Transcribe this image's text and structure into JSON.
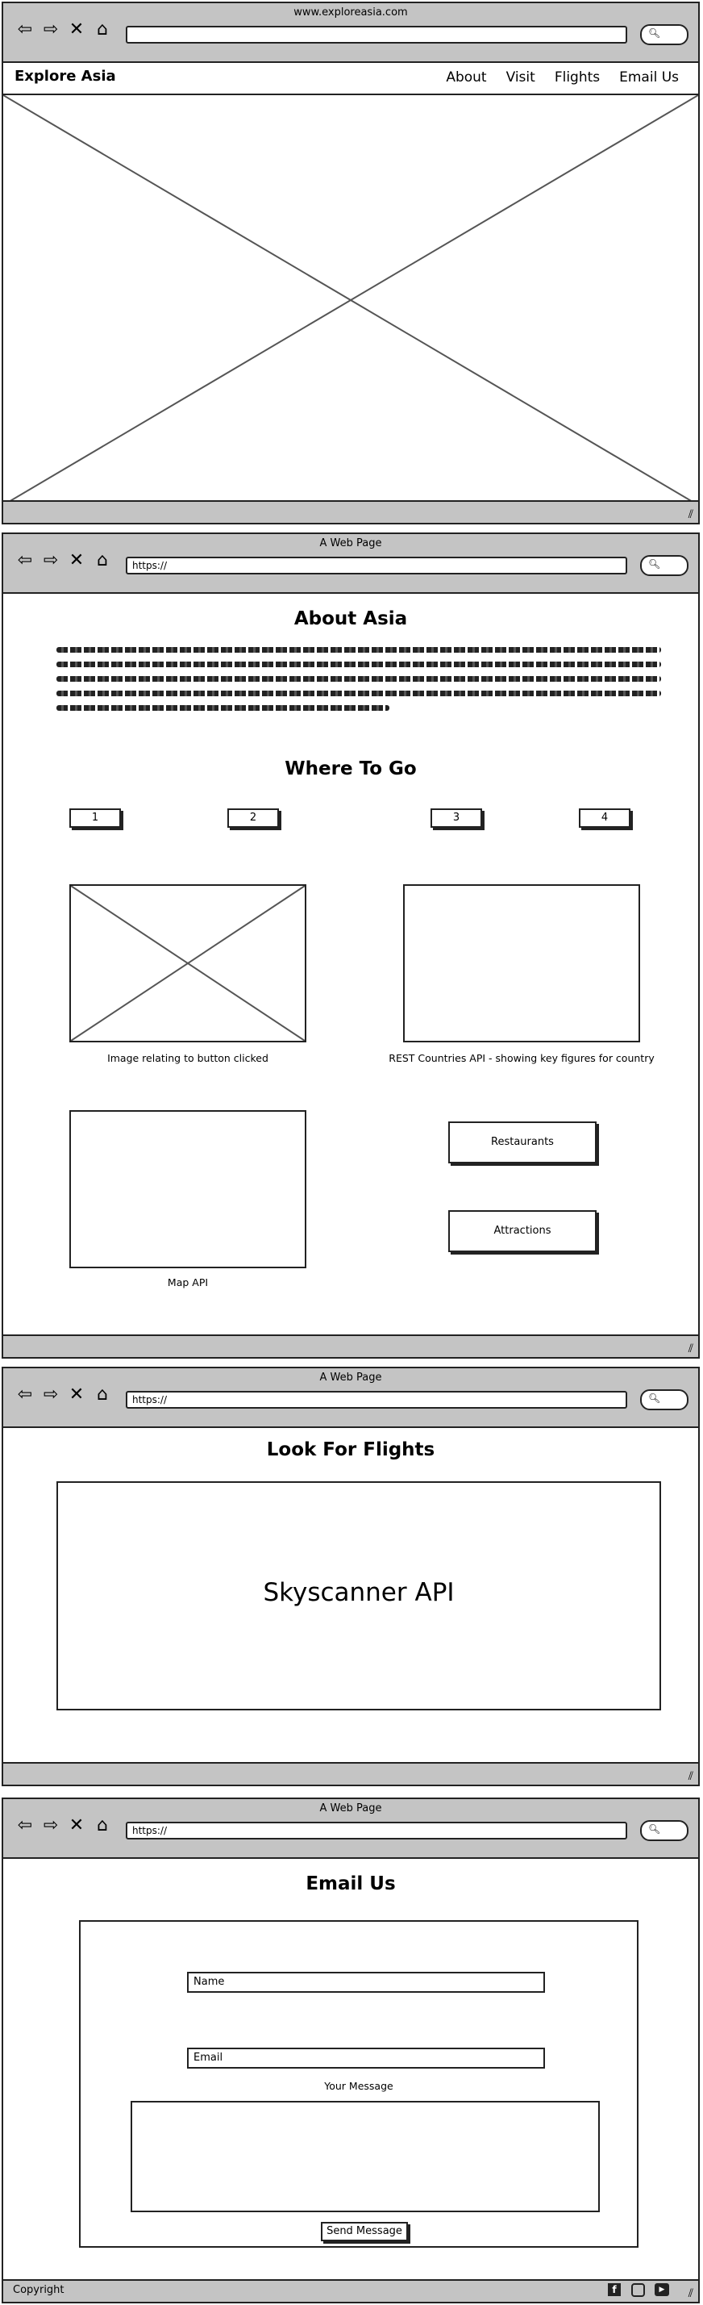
{
  "frame1": {
    "window_title": "www.exploreasia.com",
    "url": "",
    "brand": "Explore Asia",
    "nav": [
      "About",
      "Visit",
      "Flights",
      "Email Us"
    ]
  },
  "frame2": {
    "window_title": "A Web Page",
    "url": "https://",
    "about_heading": "About Asia",
    "where_heading": "Where To Go",
    "buttons": [
      "1",
      "2",
      "3",
      "4"
    ],
    "image_caption": "Image relating to button clicked",
    "api_caption": "REST Countries API - showing key figures for country",
    "map_caption": "Map API",
    "restaurants_label": "Restaurants",
    "attractions_label": "Attractions"
  },
  "frame3": {
    "window_title": "A Web Page",
    "url": "https://",
    "heading": "Look For Flights",
    "panel_text": "Skyscanner API"
  },
  "frame4": {
    "window_title": "A Web Page",
    "url": "https://",
    "heading": "Email Us",
    "name_placeholder": "Name",
    "email_placeholder": "Email",
    "message_label": "Your Message",
    "send_label": "Send Message",
    "footer_text": "Copyright",
    "social_icons": [
      "facebook-icon",
      "instagram-icon",
      "youtube-icon"
    ]
  },
  "icons": [
    "back-arrow-icon",
    "forward-arrow-icon",
    "close-icon",
    "home-icon",
    "search-icon",
    "resize-grip-icon"
  ]
}
